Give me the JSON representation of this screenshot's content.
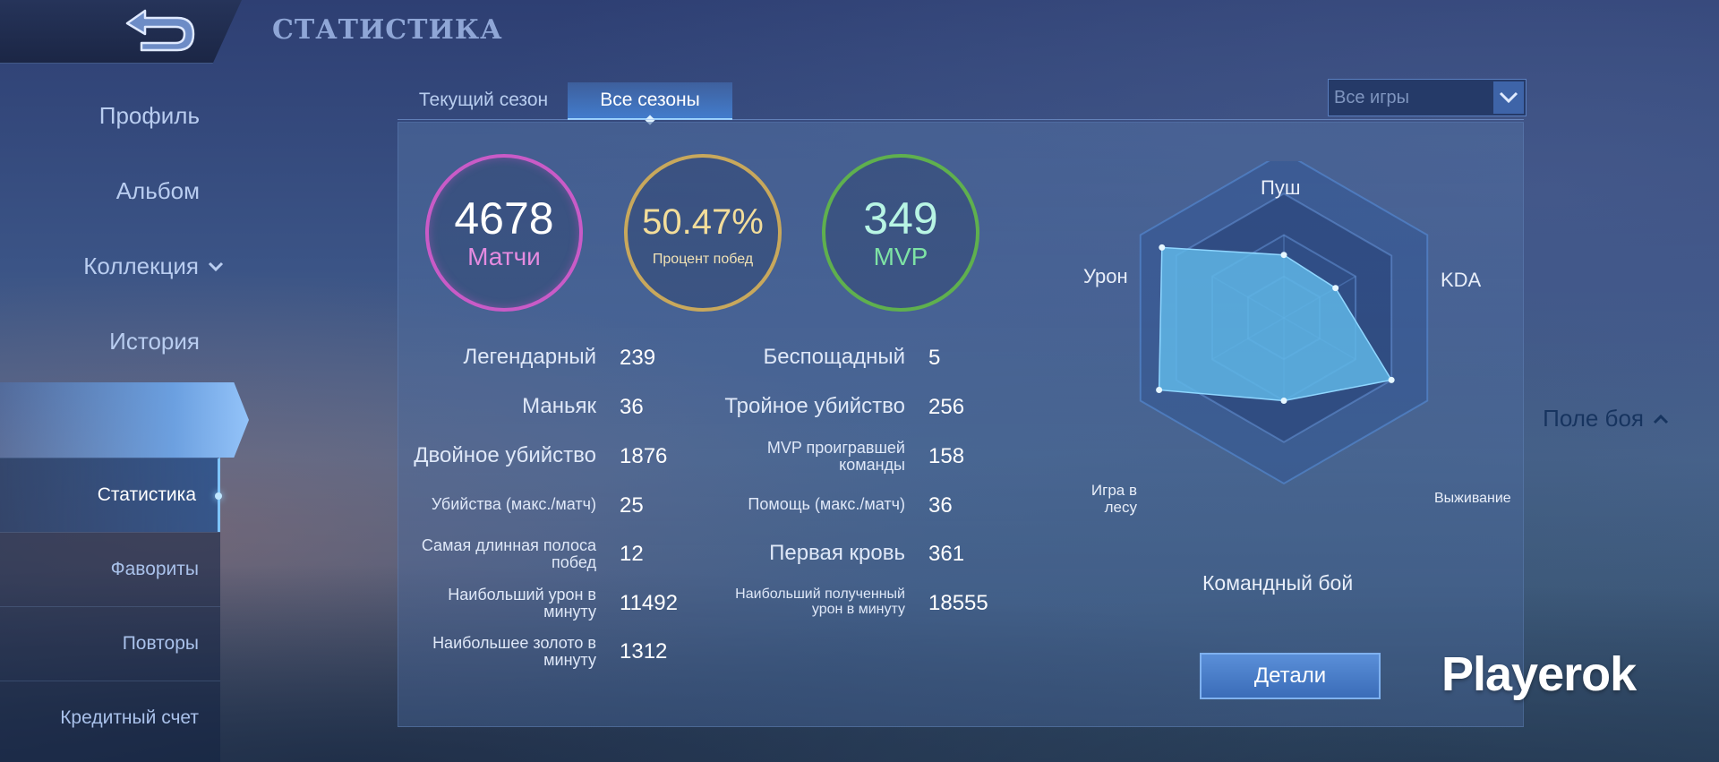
{
  "header": {
    "title": "СТАТИСТИКА",
    "back_icon": "back-arrow-icon"
  },
  "sidebar": {
    "items": [
      {
        "label": "Профиль"
      },
      {
        "label": "Альбом"
      },
      {
        "label": "Коллекция"
      },
      {
        "label": "История"
      },
      {
        "label": "Поле боя"
      }
    ],
    "subitems": [
      {
        "label": "Статистика"
      },
      {
        "label": "Фавориты"
      },
      {
        "label": "Повторы"
      },
      {
        "label": "Кредитный счет"
      }
    ]
  },
  "tabs": [
    {
      "label": "Текущий сезон"
    },
    {
      "label": "Все сезоны"
    }
  ],
  "filter": {
    "value": "Все игры"
  },
  "summary": {
    "matches": {
      "value": "4678",
      "label": "Матчи"
    },
    "winrate": {
      "value": "50.47%",
      "label": "Процент побед"
    },
    "mvp": {
      "value": "349",
      "label": "MVP"
    }
  },
  "stats_left": [
    {
      "label": "Легендарный",
      "value": "239"
    },
    {
      "label": "Маньяк",
      "value": "36"
    },
    {
      "label": "Двойное убийство",
      "value": "1876"
    },
    {
      "label": "Убийства (макс./матч)",
      "value": "25"
    },
    {
      "label": "Самая длинная полоса побед",
      "value": "12"
    },
    {
      "label": "Наибольший урон в минуту",
      "value": "11492"
    },
    {
      "label": "Наибольшее золото в минуту",
      "value": "1312"
    }
  ],
  "stats_right": [
    {
      "label": "Беспощадный",
      "value": "5"
    },
    {
      "label": "Тройное убийство",
      "value": "256"
    },
    {
      "label": "MVP проигравшей команды",
      "value": "158"
    },
    {
      "label": "Помощь (макс./матч)",
      "value": "36"
    },
    {
      "label": "Первая кровь",
      "value": "361"
    },
    {
      "label": "Наибольший полученный урон в минуту",
      "value": "18555"
    }
  ],
  "radar": {
    "labels": {
      "push": "Пуш",
      "kda": "KDA",
      "survival": "Выживание",
      "teamfight": "Командный бой",
      "jungle": "Игра в лесу",
      "damage": "Урон"
    },
    "values": {
      "push": 0.38,
      "kda": 0.36,
      "survival": 0.75,
      "teamfight": 0.5,
      "jungle": 0.87,
      "damage": 0.85
    },
    "fill_color": "#5fb6e6"
  },
  "details_button": {
    "label": "Детали"
  },
  "watermark": "Playerok"
}
